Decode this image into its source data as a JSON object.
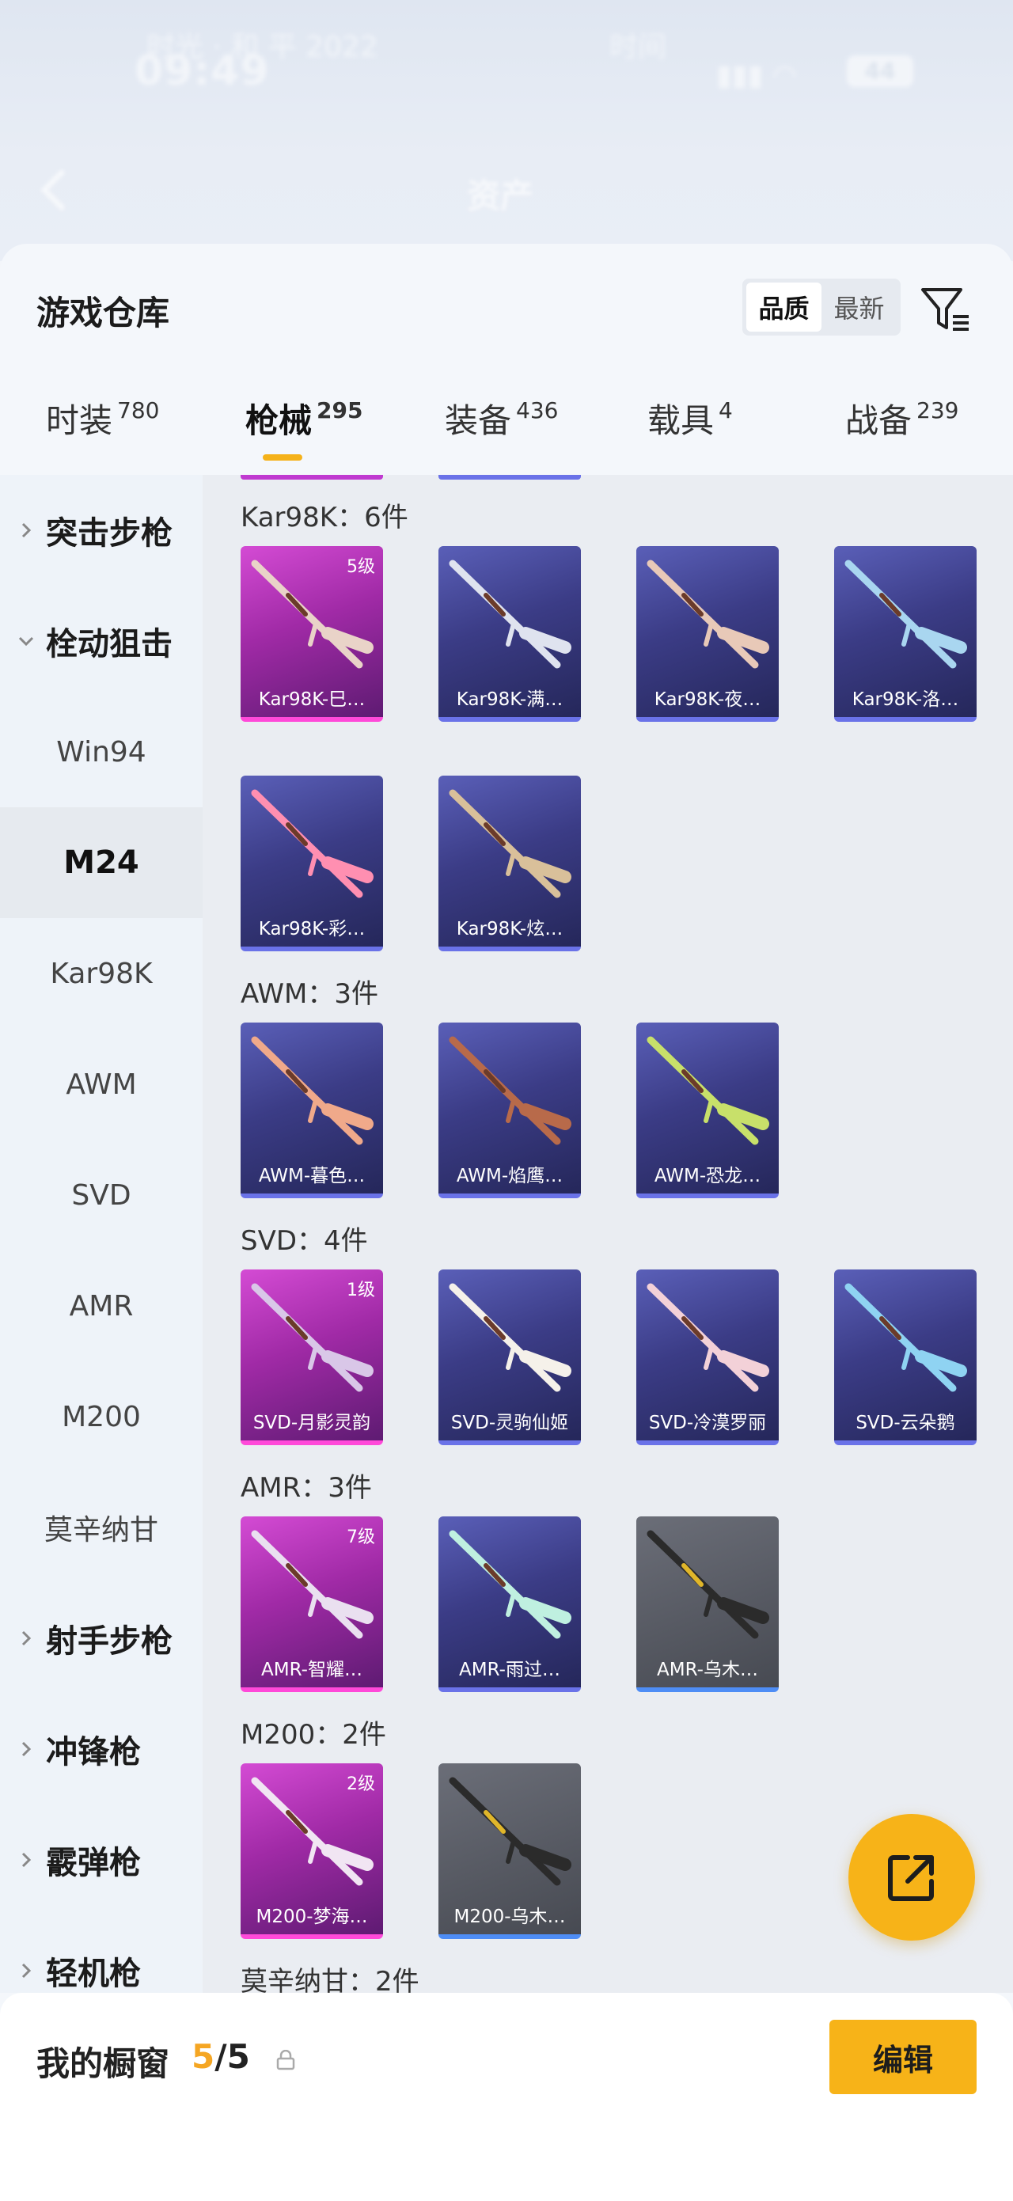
{
  "status_bar": {
    "time": "09:49",
    "carrier_left": "时光 · 和 平 2022",
    "carrier_right": "时间",
    "battery": "44"
  },
  "nav": {
    "title": "资产"
  },
  "panel": {
    "title": "游戏仓库",
    "sort_options": [
      "品质",
      "最新"
    ],
    "sort_selected": "品质"
  },
  "tabs": [
    {
      "label": "时装",
      "count": "780"
    },
    {
      "label": "枪械",
      "count": "295"
    },
    {
      "label": "装备",
      "count": "436"
    },
    {
      "label": "载具",
      "count": "4"
    },
    {
      "label": "战备",
      "count": "239"
    }
  ],
  "sidebar": {
    "items": [
      {
        "label": "突击步枪",
        "type": "category",
        "expanded": false
      },
      {
        "label": "栓动狙击",
        "type": "category",
        "expanded": true
      },
      {
        "label": "Win94",
        "type": "sub"
      },
      {
        "label": "M24",
        "type": "sub",
        "selected": true
      },
      {
        "label": "Kar98K",
        "type": "sub"
      },
      {
        "label": "AWM",
        "type": "sub"
      },
      {
        "label": "SVD",
        "type": "sub"
      },
      {
        "label": "AMR",
        "type": "sub"
      },
      {
        "label": "M200",
        "type": "sub"
      },
      {
        "label": "莫辛纳甘",
        "type": "sub"
      },
      {
        "label": "射手步枪",
        "type": "category",
        "expanded": false
      },
      {
        "label": "冲锋枪",
        "type": "category",
        "expanded": false
      },
      {
        "label": "霰弹枪",
        "type": "category",
        "expanded": false
      },
      {
        "label": "轻机枪",
        "type": "category",
        "expanded": false
      }
    ]
  },
  "groups": [
    {
      "title": "Kar98K：6件",
      "items": [
        {
          "name": "Kar98K-巳…",
          "level": "5级",
          "rarity": "pink"
        },
        {
          "name": "Kar98K-满…",
          "rarity": "purple"
        },
        {
          "name": "Kar98K-夜…",
          "rarity": "purple"
        },
        {
          "name": "Kar98K-洛…",
          "rarity": "purple"
        },
        {
          "name": "Kar98K-彩…",
          "rarity": "purple"
        },
        {
          "name": "Kar98K-炫…",
          "rarity": "purple"
        }
      ]
    },
    {
      "title": "AWM：3件",
      "items": [
        {
          "name": "AWM-暮色…",
          "rarity": "purple"
        },
        {
          "name": "AWM-焰鹰…",
          "rarity": "purple"
        },
        {
          "name": "AWM-恐龙…",
          "rarity": "purple"
        }
      ]
    },
    {
      "title": "SVD：4件",
      "items": [
        {
          "name": "SVD-月影灵韵",
          "level": "1级",
          "rarity": "pink"
        },
        {
          "name": "SVD-灵驹仙姬",
          "rarity": "purple"
        },
        {
          "name": "SVD-冷漠罗丽",
          "rarity": "purple"
        },
        {
          "name": "SVD-云朵鹅",
          "rarity": "purple"
        }
      ]
    },
    {
      "title": "AMR：3件",
      "items": [
        {
          "name": "AMR-智耀…",
          "level": "7级",
          "rarity": "pink"
        },
        {
          "name": "AMR-雨过…",
          "rarity": "purple"
        },
        {
          "name": "AMR-乌木…",
          "rarity": "grey"
        }
      ]
    },
    {
      "title": "M200：2件",
      "items": [
        {
          "name": "M200-梦海…",
          "level": "2级",
          "rarity": "pink"
        },
        {
          "name": "M200-乌木…",
          "rarity": "grey"
        }
      ]
    },
    {
      "title": "莫辛纳甘：2件",
      "items": []
    }
  ],
  "showcase": {
    "title": "我的橱窗",
    "current": "5",
    "total": "/5",
    "edit_label": "编辑"
  },
  "colors": {
    "accent": "#f7b318",
    "pink_rarity": "#c03ad0",
    "purple_rarity": "#5a5fb8",
    "grey_rarity": "#575a63"
  }
}
